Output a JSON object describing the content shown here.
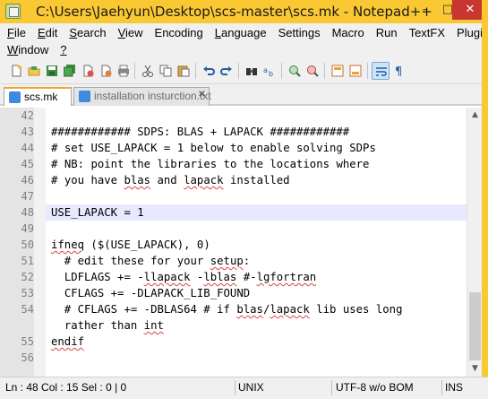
{
  "window": {
    "title": "C:\\Users\\Jaehyun\\Desktop\\scs-master\\scs.mk - Notepad++",
    "controls": {
      "minimize": "–",
      "maximize": "□",
      "close": "✕"
    }
  },
  "menu": {
    "row1": [
      {
        "u": "F",
        "rest": "ile"
      },
      {
        "u": "E",
        "rest": "dit"
      },
      {
        "u": "S",
        "rest": "earch"
      },
      {
        "u": "V",
        "rest": "iew"
      },
      {
        "u": "",
        "rest": "Encoding"
      },
      {
        "u": "L",
        "rest": "anguage"
      },
      {
        "u": "",
        "rest": "Settings"
      },
      {
        "u": "",
        "rest": "Macro"
      },
      {
        "u": "",
        "rest": "Run"
      },
      {
        "u": "",
        "rest": "TextFX"
      },
      {
        "u": "",
        "rest": "Plugins"
      }
    ],
    "row2": [
      {
        "u": "W",
        "rest": "indow"
      },
      {
        "u": "?",
        "rest": ""
      }
    ]
  },
  "toolbar": {
    "icons": [
      "new-file-icon",
      "open-file-icon",
      "save-icon",
      "save-all-icon",
      "close-icon",
      "close-all-icon",
      "print-icon",
      "cut-icon",
      "copy-icon",
      "paste-icon",
      "undo-icon",
      "redo-icon",
      "find-icon",
      "replace-icon",
      "zoom-in-icon",
      "zoom-out-icon",
      "sync-vertical-icon",
      "sync-horizontal-icon",
      "word-wrap-icon",
      "show-all-chars-icon"
    ]
  },
  "tabs": [
    {
      "label": "scs.mk",
      "active": true
    },
    {
      "label": "installation insturction.txt",
      "active": false
    }
  ],
  "editor": {
    "lines": [
      {
        "n": "42",
        "text": ""
      },
      {
        "n": "43",
        "text": "############ SDPS: BLAS + LAPACK ############"
      },
      {
        "n": "44",
        "text": "# set USE_LAPACK = 1 below to enable solving SDPs"
      },
      {
        "n": "45",
        "text": "# NB: point the libraries to the locations where"
      },
      {
        "n": "46",
        "text": "# you have blas and lapack installed"
      },
      {
        "n": "47",
        "text": ""
      },
      {
        "n": "48",
        "text": "USE_LAPACK = 1"
      },
      {
        "n": "49",
        "text": ""
      },
      {
        "n": "50",
        "text": "ifneq ($(USE_LAPACK), 0)"
      },
      {
        "n": "51",
        "text": "  # edit these for your setup:"
      },
      {
        "n": "52",
        "text": "  LDFLAGS += -llapack -lblas #-lgfortran"
      },
      {
        "n": "53",
        "text": "  CFLAGS += -DLAPACK_LIB_FOUND"
      },
      {
        "n": "54",
        "text": "  # CFLAGS += -DBLAS64 # if blas/lapack lib uses long"
      },
      {
        "n": "",
        "text": "  rather than int"
      },
      {
        "n": "55",
        "text": "endif"
      },
      {
        "n": "56",
        "text": ""
      }
    ],
    "current_line_index": 6
  },
  "status": {
    "position": "Ln : 48    Col : 15    Sel : 0 | 0",
    "eol": "UNIX",
    "encoding": "UTF-8 w/o BOM",
    "mode": "INS"
  },
  "colors": {
    "title_bar": "#f9c832",
    "close_button": "#c7372f",
    "current_line": "#e8e8ff",
    "active_tab_accent": "#f0a830"
  }
}
